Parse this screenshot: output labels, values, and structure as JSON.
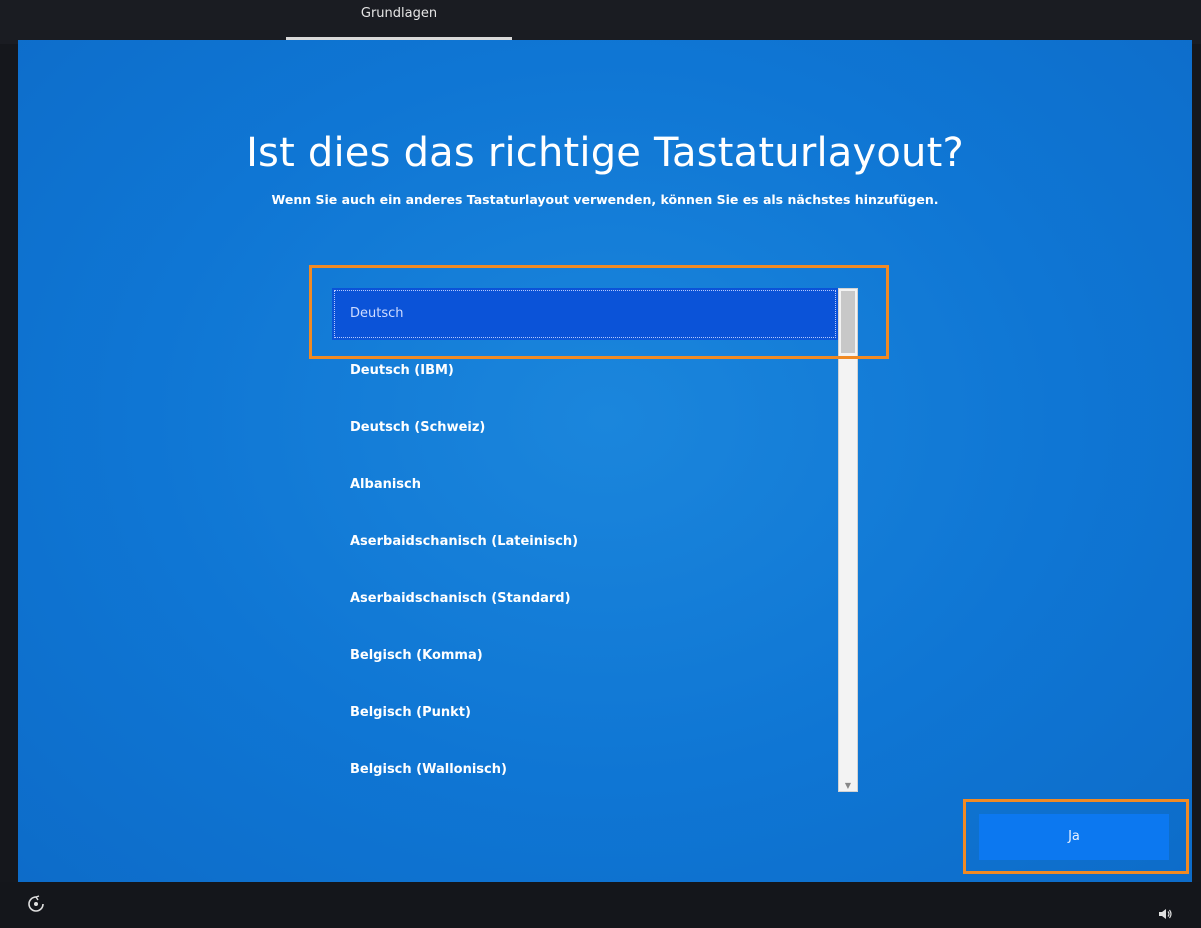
{
  "step_bar": {
    "current_step": "Grundlagen"
  },
  "main": {
    "title": "Ist dies das richtige Tastaturlayout?",
    "subtitle": "Wenn Sie auch ein anderes Tastaturlayout verwenden, können Sie es als nächstes hinzufügen."
  },
  "layout_list": {
    "selected": "Deutsch",
    "items": [
      "Deutsch",
      "Deutsch (IBM)",
      "Deutsch (Schweiz)",
      "Albanisch",
      "Aserbaidschanisch (Lateinisch)",
      "Aserbaidschanisch (Standard)",
      "Belgisch (Komma)",
      "Belgisch (Punkt)",
      "Belgisch (Wallonisch)"
    ]
  },
  "actions": {
    "confirm_label": "Ja"
  },
  "icons": {
    "bottom_left": "ease-of-access-icon",
    "bottom_right": "volume-icon"
  },
  "colors": {
    "background_blue": "#0f76d4",
    "selected_item": "#0b53d8",
    "primary_button": "#0c78f0",
    "highlight_annotation": "#f08a24"
  }
}
